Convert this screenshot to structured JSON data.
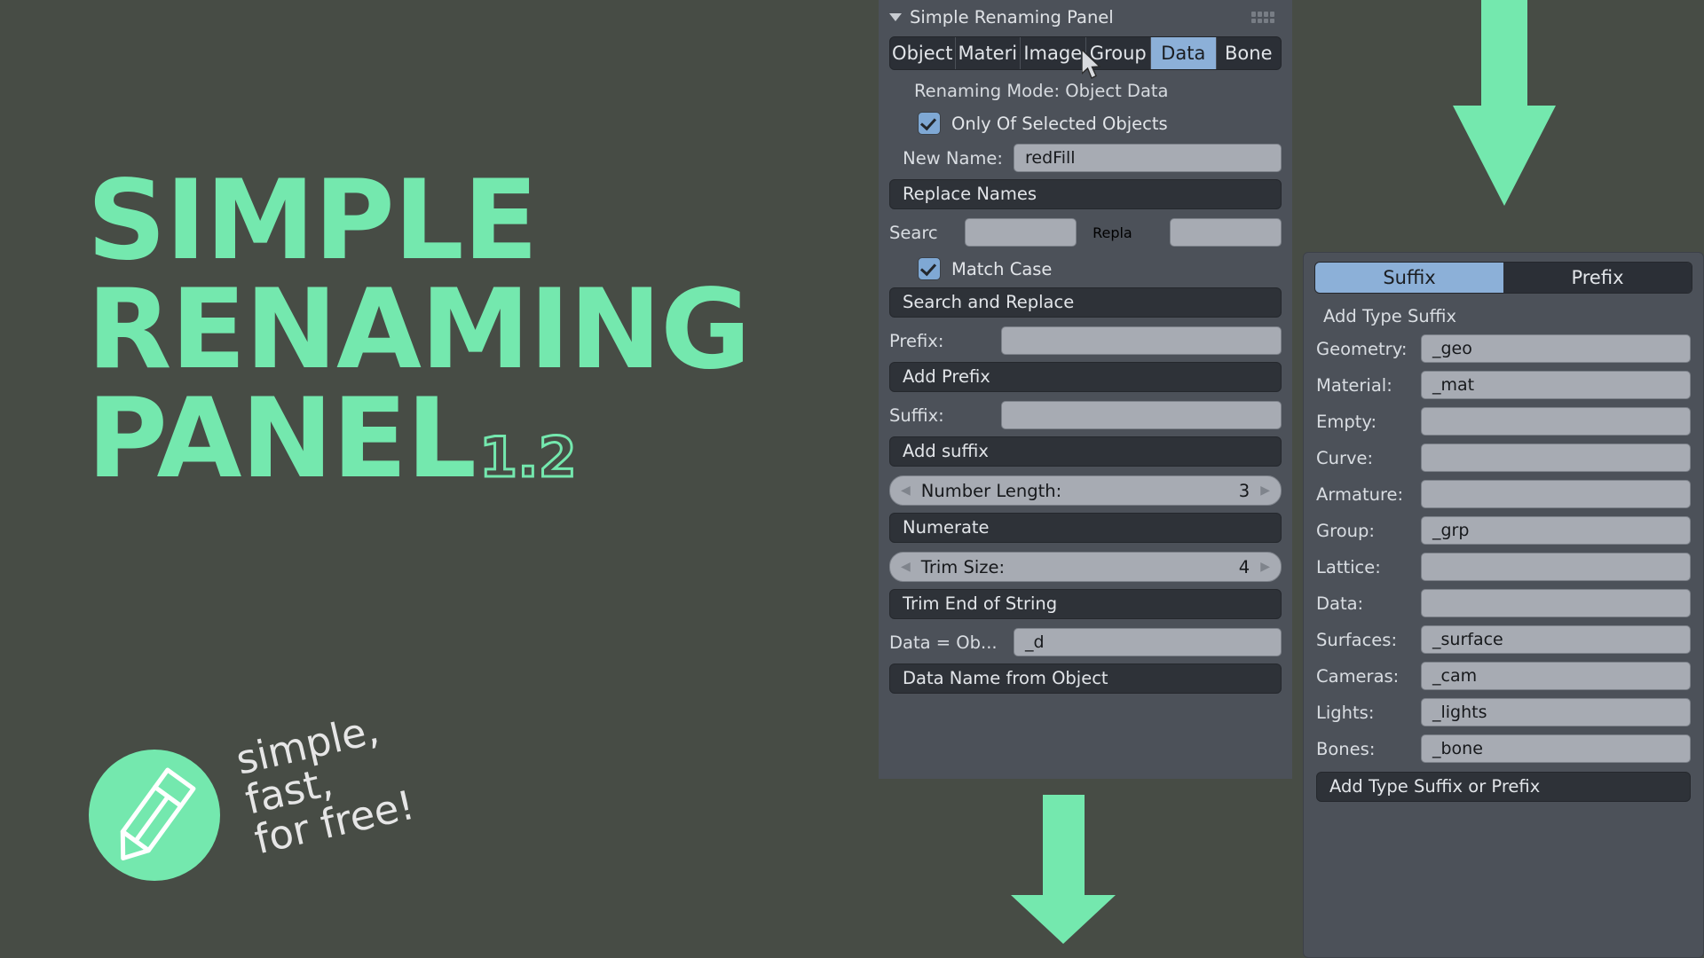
{
  "promo": {
    "title_lines": [
      "SIMPLE",
      "RENAMING",
      "PANEL"
    ],
    "version": "1.2",
    "tagline": "simple,\nfast,\nfor free!",
    "badge_icon": "pencil-icon",
    "accent_color": "#74e8ae",
    "background_color": "#474c45"
  },
  "arrows": [
    {
      "name": "arrow-down-top-right",
      "direction": "down"
    },
    {
      "name": "arrow-down-bottom-center",
      "direction": "down"
    }
  ],
  "panel": {
    "header": {
      "title": "Simple Renaming Panel",
      "collapse_icon": "triangle-down-icon",
      "grip_icon": "drag-grip-icon"
    },
    "tabs": [
      {
        "label": "Object",
        "selected": false
      },
      {
        "label": "Materi",
        "selected": false
      },
      {
        "label": "Image",
        "selected": false
      },
      {
        "label": "Group",
        "selected": false
      },
      {
        "label": "Data",
        "selected": true
      },
      {
        "label": "Bone",
        "selected": false
      }
    ],
    "mode_line": "Renaming Mode: Object Data",
    "only_selected": {
      "label": "Only Of Selected Objects",
      "checked": true
    },
    "new_name": {
      "label": "New Name:",
      "value": "redFill"
    },
    "replace_names_button": "Replace Names",
    "search_field": {
      "label": "Searc",
      "value": ""
    },
    "replace_field": {
      "label": "Repla",
      "value": ""
    },
    "match_case": {
      "label": "Match Case",
      "checked": true
    },
    "search_replace_button": "Search and Replace",
    "prefix_field": {
      "label": "Prefix:",
      "value": ""
    },
    "add_prefix_button": "Add Prefix",
    "suffix_field": {
      "label": "Suffix:",
      "value": ""
    },
    "add_suffix_button": "Add suffix",
    "number_length": {
      "label": "Number Length:",
      "value": "3"
    },
    "numerate_button": "Numerate",
    "trim_size": {
      "label": "Trim Size:",
      "value": "4"
    },
    "trim_end_button": "Trim End of String",
    "data_equals": {
      "label": "Data = Ob...",
      "value": "_d"
    },
    "data_name_button": "Data Name from Object",
    "selected_tab_color": "#8cb0d8"
  },
  "side_panel": {
    "tabs": [
      {
        "label": "Suffix",
        "selected": true
      },
      {
        "label": "Prefix",
        "selected": false
      }
    ],
    "heading": "Add Type Suffix",
    "rows": [
      {
        "label": "Geometry:",
        "value": "_geo"
      },
      {
        "label": "Material:",
        "value": "_mat"
      },
      {
        "label": "Empty:",
        "value": ""
      },
      {
        "label": "Curve:",
        "value": ""
      },
      {
        "label": "Armature:",
        "value": ""
      },
      {
        "label": "Group:",
        "value": "_grp"
      },
      {
        "label": "Lattice:",
        "value": ""
      },
      {
        "label": "Data:",
        "value": ""
      },
      {
        "label": "Surfaces:",
        "value": "_surface"
      },
      {
        "label": "Cameras:",
        "value": "_cam"
      },
      {
        "label": "Lights:",
        "value": "_lights"
      },
      {
        "label": "Bones:",
        "value": "_bone"
      }
    ],
    "apply_button": "Add Type Suffix or Prefix"
  }
}
